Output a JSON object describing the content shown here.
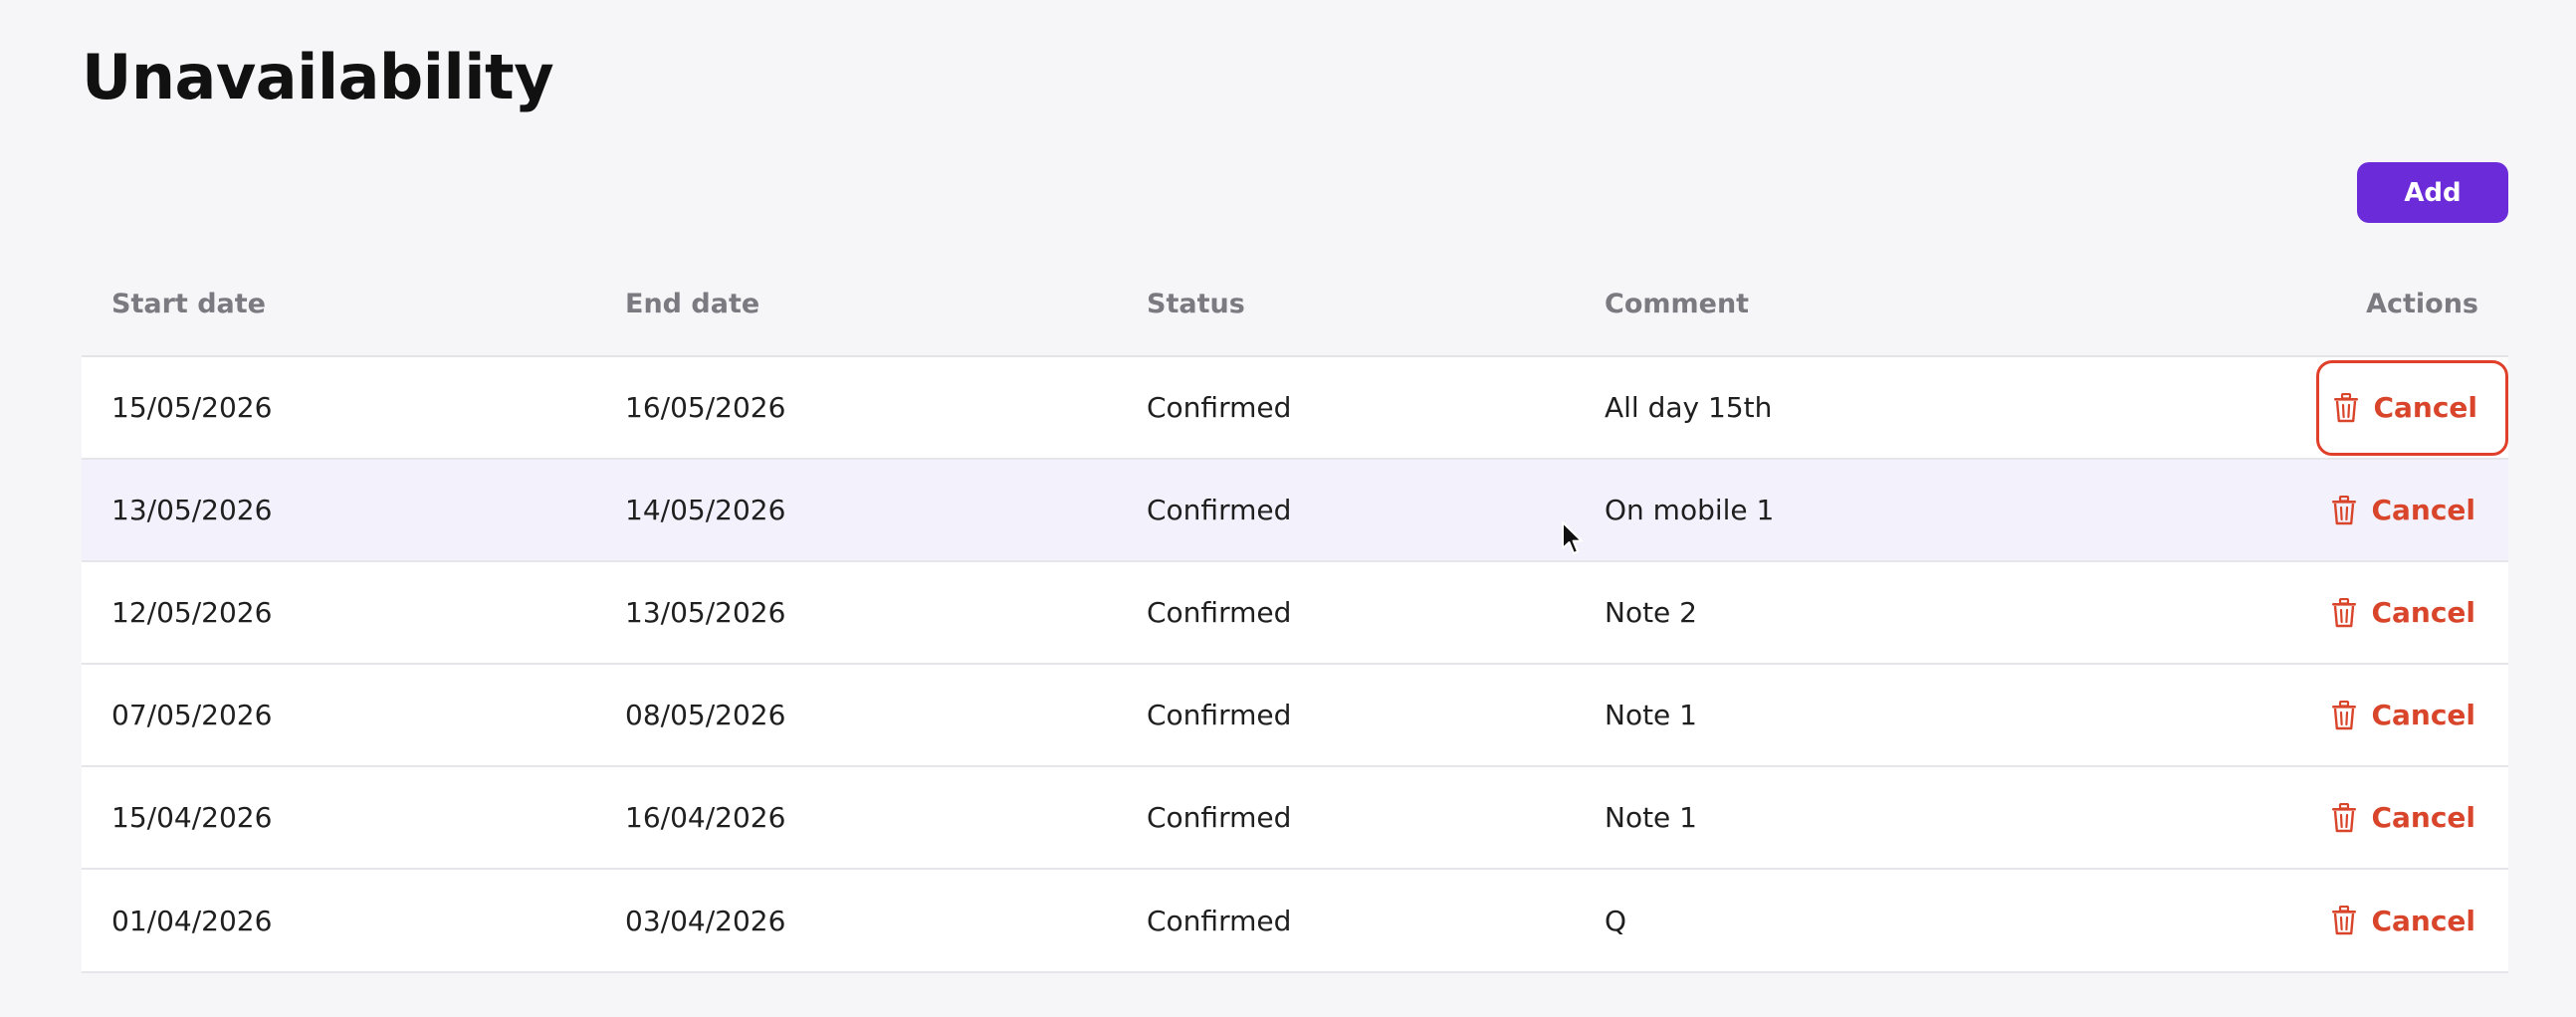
{
  "page": {
    "title": "Unavailability"
  },
  "toolbar": {
    "add_label": "Add"
  },
  "table": {
    "headers": {
      "start_date": "Start date",
      "end_date": "End date",
      "status": "Status",
      "comment": "Comment",
      "actions": "Actions"
    },
    "rows": [
      {
        "start_date": "15/05/2026",
        "end_date": "16/05/2026",
        "status": "Confirmed",
        "comment": "All day 15th",
        "action_label": "Cancel"
      },
      {
        "start_date": "13/05/2026",
        "end_date": "14/05/2026",
        "status": "Confirmed",
        "comment": "On mobile 1",
        "action_label": "Cancel"
      },
      {
        "start_date": "12/05/2026",
        "end_date": "13/05/2026",
        "status": "Confirmed",
        "comment": "Note 2",
        "action_label": "Cancel"
      },
      {
        "start_date": "07/05/2026",
        "end_date": "08/05/2026",
        "status": "Confirmed",
        "comment": "Note 1",
        "action_label": "Cancel"
      },
      {
        "start_date": "15/04/2026",
        "end_date": "16/04/2026",
        "status": "Confirmed",
        "comment": "Note 1",
        "action_label": "Cancel"
      },
      {
        "start_date": "01/04/2026",
        "end_date": "03/04/2026",
        "status": "Confirmed",
        "comment": "Q",
        "action_label": "Cancel"
      }
    ]
  },
  "icons": {
    "row_action": "trash-icon"
  },
  "colors": {
    "accent": "#6c2bd9",
    "danger": "#d9452b",
    "hover_row": "#f3f1fc",
    "background": "#f6f6f8"
  }
}
